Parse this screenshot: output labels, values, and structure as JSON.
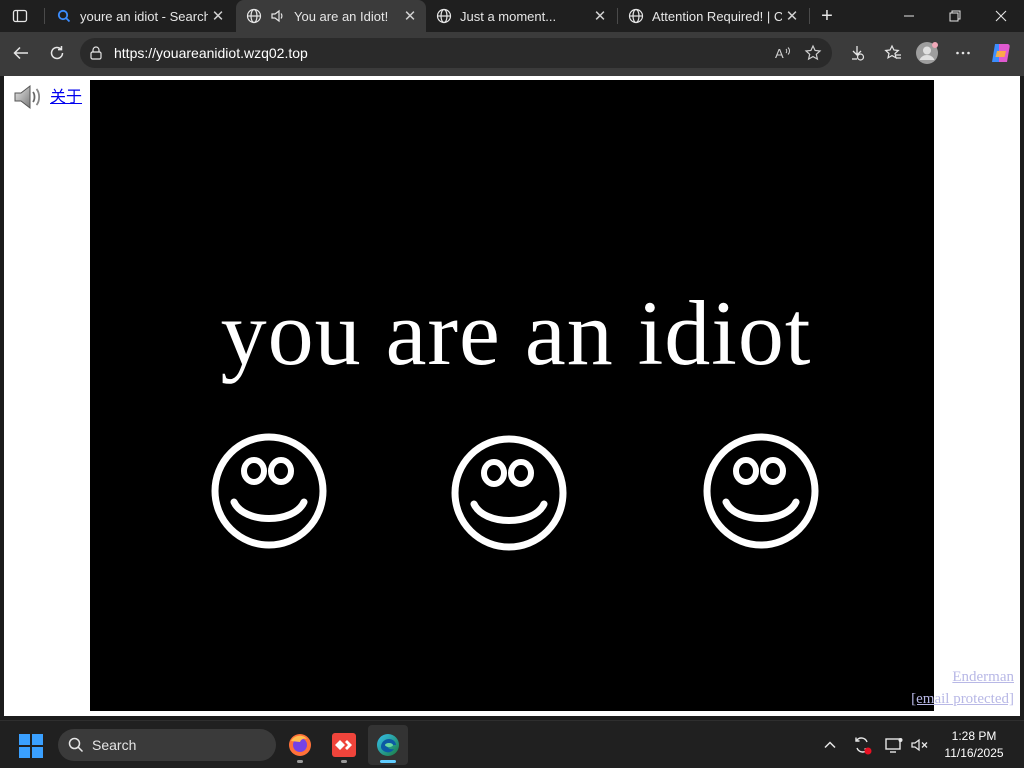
{
  "browser": {
    "tabs": [
      {
        "title": "youre an idiot - Search",
        "icon": "search-icon",
        "active": false
      },
      {
        "title": "You are an Idiot!",
        "icon": "globe-icon",
        "active": true,
        "audio": true
      },
      {
        "title": "Just a moment...",
        "icon": "globe-icon",
        "active": false
      },
      {
        "title": "Attention Required! | Clo",
        "icon": "globe-icon",
        "active": false
      }
    ],
    "url": "https://youareanidiot.wzq02.top",
    "accent": "#60cdff"
  },
  "page": {
    "about_link": "关于",
    "headline": "you are an idiot",
    "smiley_count": 3,
    "credits": {
      "line1": "Enderman",
      "line2": "[email protected]"
    }
  },
  "taskbar": {
    "search_label": "Search",
    "apps": [
      "firefox-icon",
      "anydesk-icon",
      "edge-icon"
    ],
    "time": "1:28 PM",
    "date": "11/16/2025"
  }
}
